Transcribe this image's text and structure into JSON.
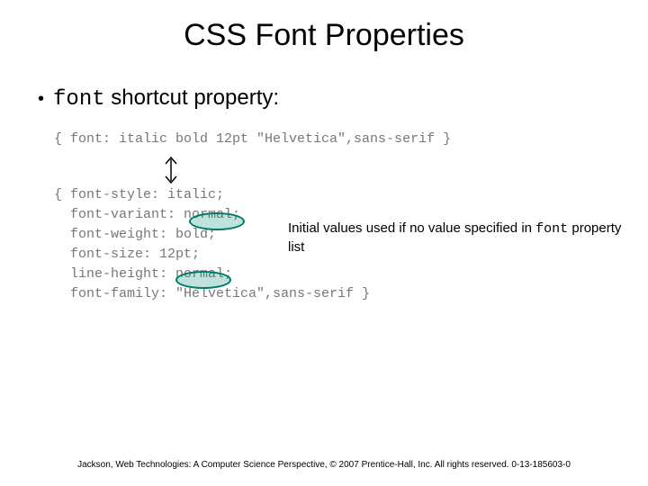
{
  "title": "CSS Font Properties",
  "bullet": {
    "mono": "font",
    "rest": " shortcut property:"
  },
  "code": {
    "l1": "{ font: italic bold 12pt \"Helvetica\",sans-serif }",
    "l2": "{ font-style: italic;",
    "l3": "  font-variant: normal;",
    "l4": "  font-weight: bold;",
    "l5": "  font-size: 12pt;",
    "l6": "  line-height: normal;",
    "l7": "  font-family: \"Helvetica\",sans-serif }"
  },
  "annotation": {
    "pre": "Initial values used if no value specified in ",
    "mono": "font",
    "post": " property list"
  },
  "footer": "Jackson, Web Technologies: A Computer Science Perspective, © 2007 Prentice-Hall, Inc. All rights reserved. 0-13-185603-0"
}
